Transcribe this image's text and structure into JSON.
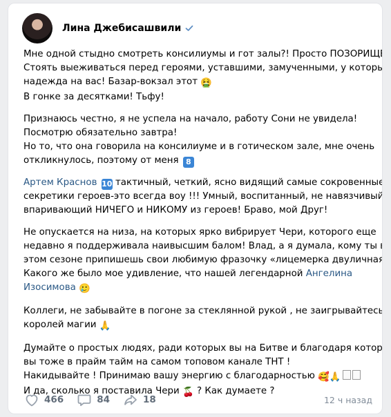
{
  "post": {
    "author": "Лина Джебисашвили",
    "paragraphs": {
      "p1": {
        "l1": "Мне одной стыдно смотреть консилиумы и гот залы?! Просто ПОЗОРИЩЕ!",
        "l2": "Стоять выеживаться перед героями, уставшими, замученными, у которых",
        "l3": "надежда на вас! Базар-вокзал этот ",
        "l4": "В гонке за десятками! Тьфу!"
      },
      "p2": {
        "l1": "Признаюсь честно, я не успела на начало, работу Сони не увидела!",
        "l2": "Посмотрю обязательно завтра!",
        "l3": "Но то, что она говорила на консилиуме и в готическом зале, мне очень",
        "l4": "откликнулось, поэтому от меня "
      },
      "p3": {
        "mention": "Артем Краснов",
        "l1": " тактичный, четкий, ясно видящий самые сокровенные",
        "l2": "секретики героев-это всегда воу !!! Умный, воспитанный, не навязчивый, не",
        "l3": "впаривающий НИЧЕГО и НИКОМУ из героев! Браво, мой Друг!"
      },
      "p4": {
        "l1": "Не опускается на низа, на которых ярко вибрирует Чери, которого еще",
        "l2": "недавно я поддерживала наивысшим балом! Влад, а я думала, кому ты в",
        "l3": "этом сезоне припишешь свои любимую фразочку «лицемерка двуличная» ?!",
        "l4": "Какого же было мое удивление, что нашей легендарной ",
        "mention_a": "Ангелина",
        "mention_b": "Изосимова"
      },
      "p5": {
        "l1": "Коллеги, не забывайте в погоне за стеклянной рукой , не заигрывайтесь в",
        "l2": "королей магии "
      },
      "p6": {
        "l1": "Думайте о простых людях, ради которых вы на Битве и благодаря которым",
        "l2": "вы тоже в прайм тайм на самом топовом канале ТНТ !",
        "l3": "Накидывайте ! Принимаю вашу энергию с благодарностью ",
        "l4a": "И да, сколько я поставила Чери ",
        "l4b": " ? Как думаете ?"
      }
    },
    "emoji": {
      "nauseated": "🤮",
      "pray": "🙏",
      "smiling_hearts": "🥰",
      "smile": "🥲",
      "cherries": "🍒"
    },
    "badges": {
      "eight": "8",
      "ten": "10"
    },
    "stats": {
      "likes": "466",
      "comments": "84",
      "shares": "18"
    },
    "time": "12 ч назад"
  },
  "colors": {
    "link": "#2a5885",
    "badge": "#3b86d6",
    "verified": "#5f8fc4"
  }
}
